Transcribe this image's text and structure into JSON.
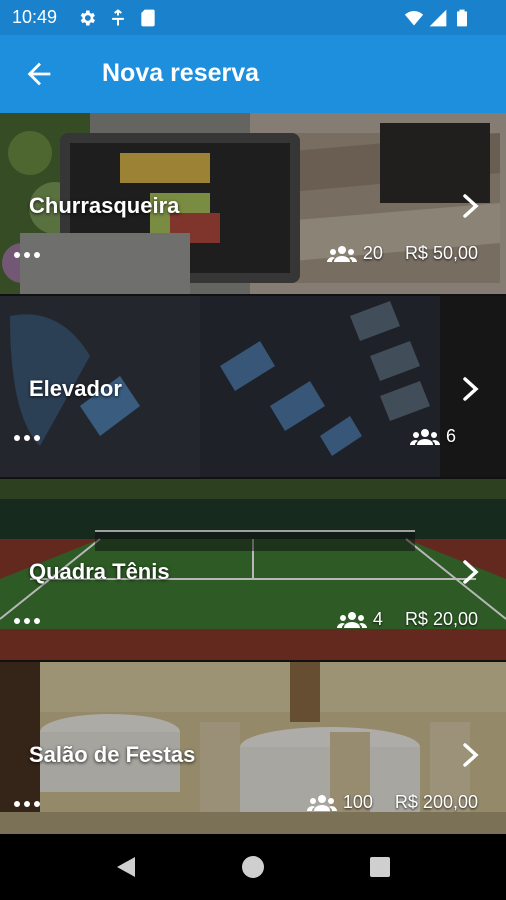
{
  "status": {
    "time": "10:49"
  },
  "appbar": {
    "title": "Nova reserva"
  },
  "items": [
    {
      "name": "Churrasqueira",
      "capacity": "20",
      "price": "R$ 50,00"
    },
    {
      "name": "Elevador",
      "capacity": "6",
      "price": ""
    },
    {
      "name": "Quadra Tênis",
      "capacity": "4",
      "price": "R$ 20,00"
    },
    {
      "name": "Salão de Festas",
      "capacity": "100",
      "price": "R$ 200,00"
    }
  ],
  "colors": {
    "statusbar": "#1a82cc",
    "appbar": "#1e8fdd",
    "text": "#ffffff"
  },
  "icons": [
    "settings-icon",
    "data-saver-icon",
    "sd-card-icon",
    "wifi-icon",
    "signal-icon",
    "battery-icon",
    "back-arrow-icon",
    "chevron-right-icon",
    "more-dots-icon",
    "group-icon",
    "nav-back-icon",
    "nav-home-icon",
    "nav-recents-icon"
  ]
}
